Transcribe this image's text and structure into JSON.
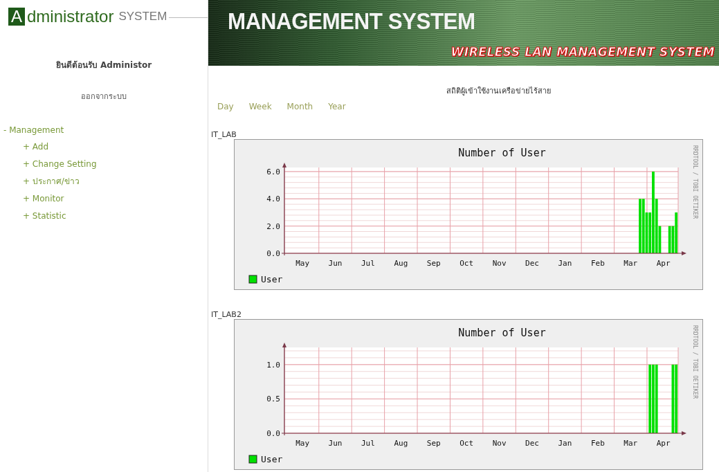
{
  "logo": {
    "letter": "A",
    "name": "dministrator",
    "suffix": "SYSTEM"
  },
  "sidebar": {
    "welcome": "ยินดีต้อนรับ Administor",
    "logout": "ออกจากระบบ",
    "menu": [
      {
        "marker": "-",
        "label": "Management",
        "children": [
          {
            "marker": "+",
            "label": "Add"
          },
          {
            "marker": "+",
            "label": "Change Setting"
          },
          {
            "marker": "+",
            "label": "ประกาศ/ข่าว"
          },
          {
            "marker": "+",
            "label": "Monitor"
          },
          {
            "marker": "+",
            "label": "Statistic"
          }
        ]
      }
    ]
  },
  "banner": {
    "title": "MANAGEMENT SYSTEM",
    "subtitle": "WIRELESS LAN MANAGEMENT SYSTEM"
  },
  "page_title": "สถิติผู้เข้าใช้งานเครือข่ายไร้สาย",
  "periods": [
    "Day",
    "Week",
    "Month",
    "Year"
  ],
  "graphs": [
    {
      "label": "IT_LAB",
      "credit": "RRDTOOL / TOBI OETIKER",
      "chart_data": {
        "type": "bar",
        "title": "Number of User",
        "grid": true,
        "ylim": [
          0,
          6.3
        ],
        "categories": [
          null,
          null,
          null,
          null,
          null,
          "May",
          null,
          null,
          null,
          null,
          null,
          null,
          null,
          null,
          null,
          "Jun",
          null,
          null,
          null,
          null,
          null,
          null,
          null,
          null,
          null,
          "Jul",
          null,
          null,
          null,
          null,
          null,
          null,
          null,
          null,
          null,
          "Aug",
          null,
          null,
          null,
          null,
          null,
          null,
          null,
          null,
          null,
          "Sep",
          null,
          null,
          null,
          null,
          null,
          null,
          null,
          null,
          null,
          "Oct",
          null,
          null,
          null,
          null,
          null,
          null,
          null,
          null,
          null,
          "Nov",
          null,
          null,
          null,
          null,
          null,
          null,
          null,
          null,
          null,
          "Dec",
          null,
          null,
          null,
          null,
          null,
          null,
          null,
          null,
          null,
          "Jan",
          null,
          null,
          null,
          null,
          null,
          null,
          null,
          null,
          null,
          "Feb",
          null,
          null,
          null,
          null,
          null,
          null,
          null,
          null,
          null,
          "Mar",
          null,
          null,
          null,
          null,
          null,
          null,
          null,
          null,
          null,
          "Apr",
          null,
          null,
          null,
          null
        ],
        "yticks": [
          {
            "value": 0,
            "label": "0.0"
          },
          {
            "value": 2,
            "label": "2.0"
          },
          {
            "value": 4,
            "label": "4.0"
          },
          {
            "value": 6,
            "label": "6.0"
          }
        ],
        "series": [
          {
            "name": "User",
            "color": "#00e000",
            "values": [
              null,
              null,
              null,
              null,
              null,
              null,
              null,
              null,
              null,
              null,
              null,
              null,
              null,
              null,
              null,
              null,
              null,
              null,
              null,
              null,
              null,
              null,
              null,
              null,
              null,
              null,
              null,
              null,
              null,
              null,
              null,
              null,
              null,
              null,
              null,
              null,
              null,
              null,
              null,
              null,
              null,
              null,
              null,
              null,
              null,
              null,
              null,
              null,
              null,
              null,
              null,
              null,
              null,
              null,
              null,
              null,
              null,
              null,
              null,
              null,
              null,
              null,
              null,
              null,
              null,
              null,
              null,
              null,
              null,
              null,
              null,
              null,
              null,
              null,
              null,
              null,
              null,
              null,
              null,
              null,
              null,
              null,
              null,
              null,
              null,
              null,
              null,
              null,
              null,
              null,
              null,
              null,
              null,
              null,
              null,
              null,
              null,
              null,
              null,
              null,
              null,
              null,
              null,
              null,
              null,
              null,
              null,
              null,
              4,
              4,
              3,
              3,
              6,
              4,
              2,
              null,
              null,
              2,
              2,
              3
            ]
          }
        ]
      }
    },
    {
      "label": "IT_LAB2",
      "credit": "RRDTOOL / TOBI OETIKER",
      "chart_data": {
        "type": "bar",
        "title": "Number of User",
        "grid": true,
        "ylim": [
          0,
          1.25
        ],
        "categories": [
          null,
          null,
          null,
          null,
          null,
          "May",
          null,
          null,
          null,
          null,
          null,
          null,
          null,
          null,
          null,
          "Jun",
          null,
          null,
          null,
          null,
          null,
          null,
          null,
          null,
          null,
          "Jul",
          null,
          null,
          null,
          null,
          null,
          null,
          null,
          null,
          null,
          "Aug",
          null,
          null,
          null,
          null,
          null,
          null,
          null,
          null,
          null,
          "Sep",
          null,
          null,
          null,
          null,
          null,
          null,
          null,
          null,
          null,
          "Oct",
          null,
          null,
          null,
          null,
          null,
          null,
          null,
          null,
          null,
          "Nov",
          null,
          null,
          null,
          null,
          null,
          null,
          null,
          null,
          null,
          "Dec",
          null,
          null,
          null,
          null,
          null,
          null,
          null,
          null,
          null,
          "Jan",
          null,
          null,
          null,
          null,
          null,
          null,
          null,
          null,
          null,
          "Feb",
          null,
          null,
          null,
          null,
          null,
          null,
          null,
          null,
          null,
          "Mar",
          null,
          null,
          null,
          null,
          null,
          null,
          null,
          null,
          null,
          "Apr",
          null,
          null,
          null,
          null
        ],
        "yticks": [
          {
            "value": 0,
            "label": "0.0"
          },
          {
            "value": 0.5,
            "label": "0.5"
          },
          {
            "value": 1,
            "label": "1.0"
          }
        ],
        "series": [
          {
            "name": "User",
            "color": "#00e000",
            "values": [
              null,
              null,
              null,
              null,
              null,
              null,
              null,
              null,
              null,
              null,
              null,
              null,
              null,
              null,
              null,
              null,
              null,
              null,
              null,
              null,
              null,
              null,
              null,
              null,
              null,
              null,
              null,
              null,
              null,
              null,
              null,
              null,
              null,
              null,
              null,
              null,
              null,
              null,
              null,
              null,
              null,
              null,
              null,
              null,
              null,
              null,
              null,
              null,
              null,
              null,
              null,
              null,
              null,
              null,
              null,
              null,
              null,
              null,
              null,
              null,
              null,
              null,
              null,
              null,
              null,
              null,
              null,
              null,
              null,
              null,
              null,
              null,
              null,
              null,
              null,
              null,
              null,
              null,
              null,
              null,
              null,
              null,
              null,
              null,
              null,
              null,
              null,
              null,
              null,
              null,
              null,
              null,
              null,
              null,
              null,
              null,
              null,
              null,
              null,
              null,
              null,
              null,
              null,
              null,
              null,
              null,
              null,
              null,
              null,
              null,
              null,
              1,
              1,
              1,
              null,
              null,
              null,
              null,
              1,
              1
            ]
          }
        ]
      }
    }
  ]
}
